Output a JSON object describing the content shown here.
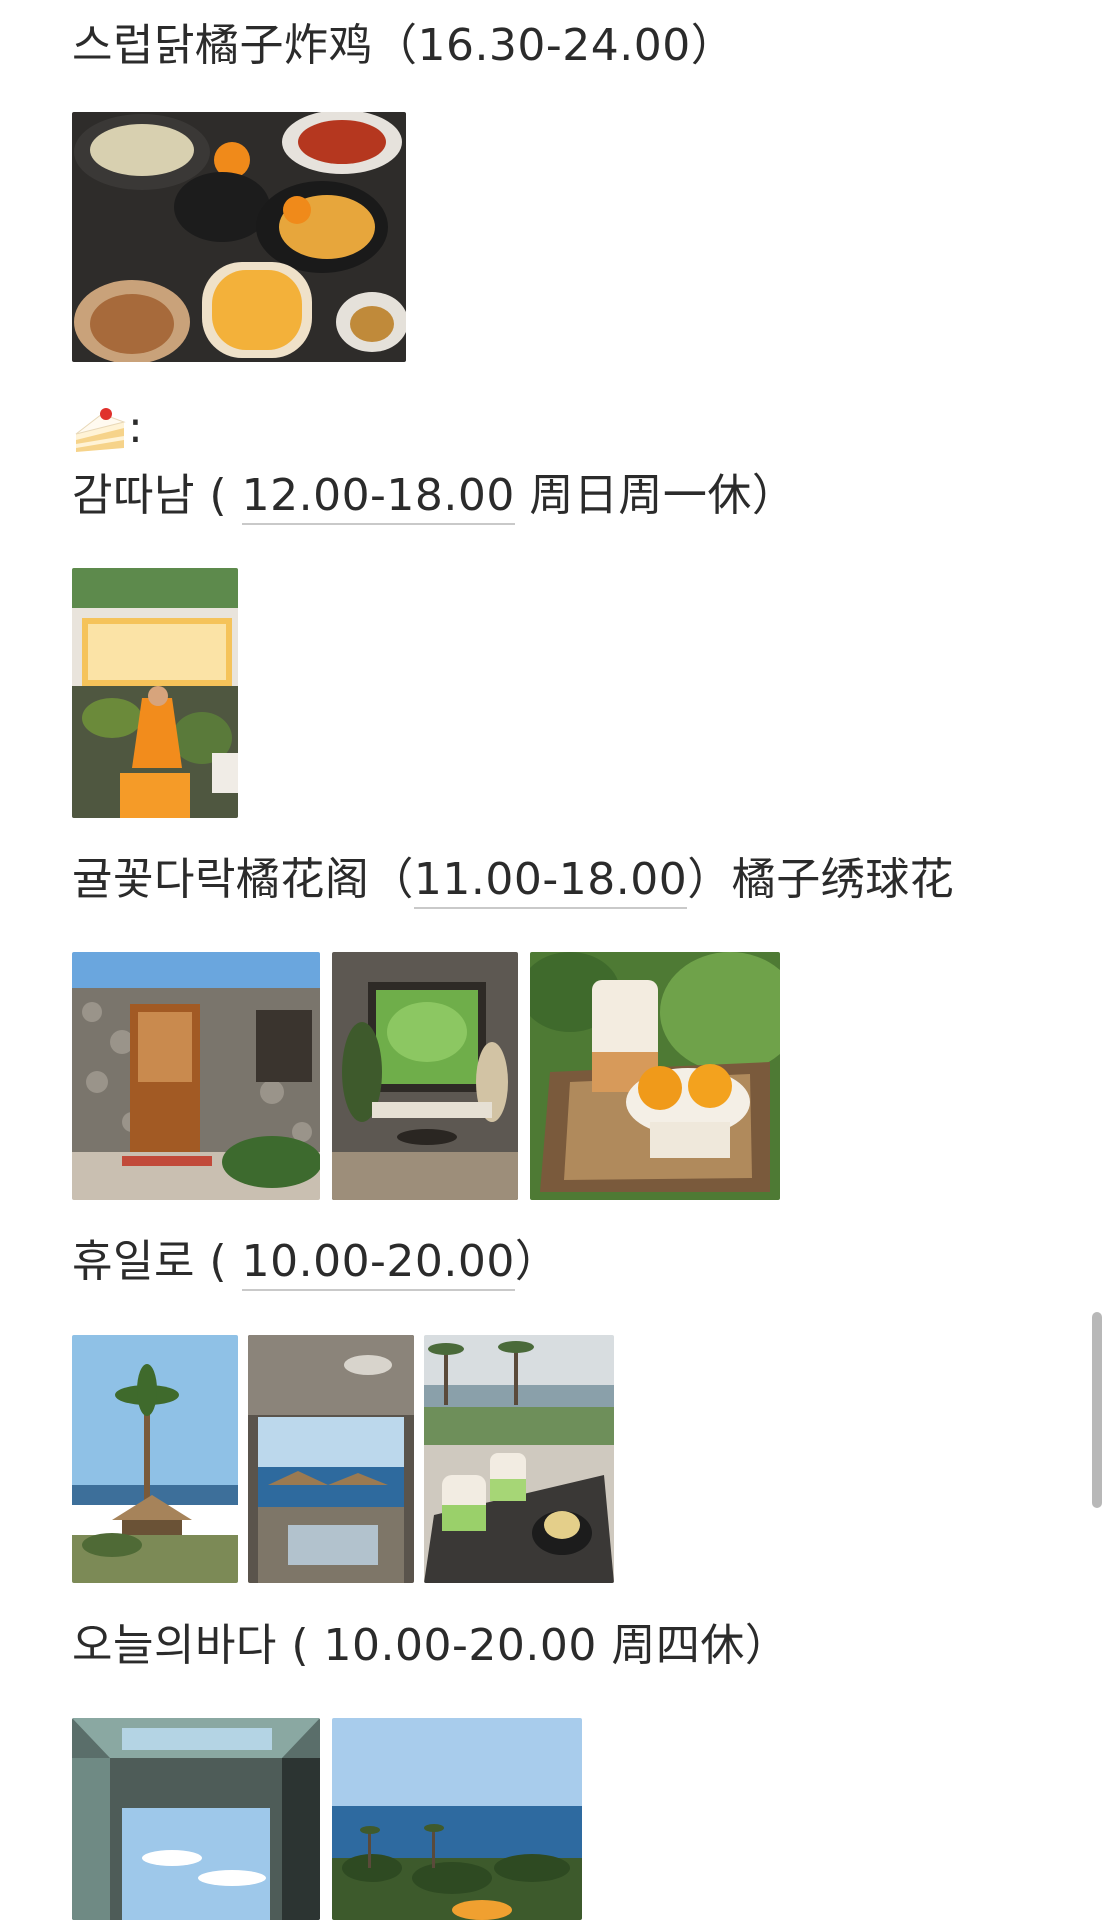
{
  "sections": [
    {
      "id": "fried-chicken",
      "title": "스럽닭橘子炸鸡（16.30-24.00）",
      "title_parts": {
        "name": "스럽닭橘子炸鸡（",
        "hours": "16.30-24.00",
        "tail": "）"
      }
    },
    {
      "id": "dessert-header",
      "emoji_label": ":"
    },
    {
      "id": "gamttanam",
      "title_parts": {
        "name": "감따남 ( ",
        "hours": "12.00-18.00",
        "tail": " 周日周一休）"
      }
    },
    {
      "id": "gyulkkot",
      "title_parts": {
        "name": "귤꽃다락橘花阁（",
        "hours": "11.00-18.00",
        "tail": "）橘子绣球花"
      }
    },
    {
      "id": "hyuillo",
      "title_parts": {
        "name": "휴일로 ( ",
        "hours": "10.00-20.00",
        "tail": "）"
      }
    },
    {
      "id": "oneului-bada",
      "title_parts": {
        "name": "오늘의바다 ( 10.00-20.00 周四休）"
      }
    }
  ],
  "icons": {
    "cake": "cake-slice-icon"
  },
  "colors": {
    "text": "#2b2b2b",
    "underline": "#c9c9c9",
    "background": "#ffffff",
    "scrollbar": "#b8b8b8"
  }
}
